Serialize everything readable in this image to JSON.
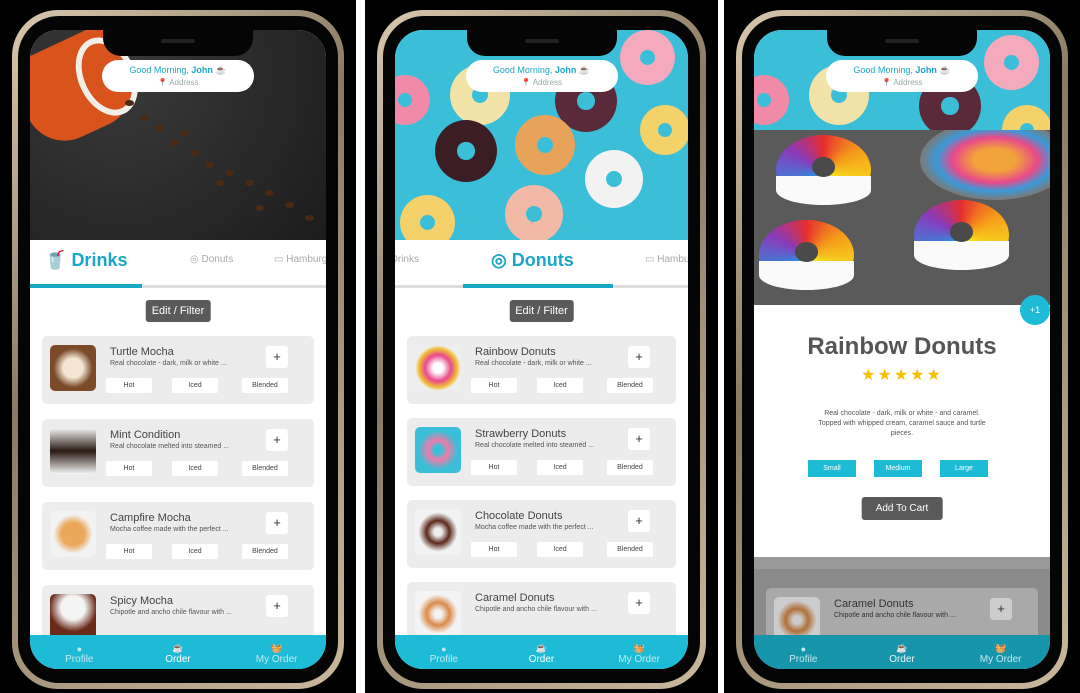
{
  "greeting": {
    "text": "Good Morning,",
    "name": "John",
    "address": "Address"
  },
  "tabs": {
    "drinks": "Drinks",
    "donuts": "Donuts",
    "hamburgers": "Hamburgers"
  },
  "filter_label": "Edit / Filter",
  "options": {
    "hot": "Hot",
    "iced": "Iced",
    "blended": "Blended"
  },
  "plus": "+",
  "drinks": [
    {
      "name": "Turtle Mocha",
      "desc": "Real chocolate - dark, milk or white ..."
    },
    {
      "name": "Mint Condition",
      "desc": "Real chocolate melted into steamed ..."
    },
    {
      "name": "Campfire Mocha",
      "desc": "Mocha coffee made with the perfect ..."
    },
    {
      "name": "Spicy Mocha",
      "desc": "Chipotle and ancho chile flavour with ..."
    }
  ],
  "donuts": [
    {
      "name": "Rainbow Donuts",
      "desc": "Real chocolate - dark, milk or white ..."
    },
    {
      "name": "Strawberry Donuts",
      "desc": "Real chocolate melted into steamed ..."
    },
    {
      "name": "Chocolate Donuts",
      "desc": "Mocha coffee made with the perfect ..."
    },
    {
      "name": "Caramel Donuts",
      "desc": "Chipotle and ancho chile flavour with ..."
    }
  ],
  "detail": {
    "badge": "+1",
    "title": "Rainbow Donuts",
    "rating": 5,
    "stars": "★★★★★",
    "desc": "Real chocolate - dark, milk or white - and caramel. Topped with whipped cream, caramel sauce and turtle pieces.",
    "sizes": [
      "Small",
      "Medium",
      "Large"
    ],
    "add_to_cart": "Add To Cart"
  },
  "nav": {
    "profile": "Profile",
    "order": "Order",
    "my_order": "My Order"
  },
  "colors": {
    "accent": "#1dbbd6",
    "button_dark": "#5a5a5a"
  }
}
